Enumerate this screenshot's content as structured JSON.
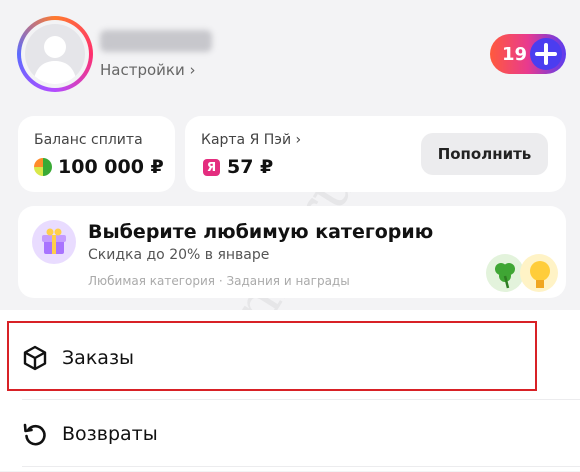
{
  "profile": {
    "name_hidden": true,
    "settings_label": "Настройки ›",
    "plus_count": "19"
  },
  "balance": {
    "split_label": "Баланс сплита",
    "split_value": "100 000 ₽",
    "pay_label": "Карта Я Пэй ›",
    "pay_value": "57 ₽",
    "pay_icon_letter": "Я",
    "topup_label": "Пополнить"
  },
  "category": {
    "title": "Выберите любимую категорию",
    "subtitle": "Скидка до 20% в январе",
    "chips": "Любимая категория · Задания и награды"
  },
  "menu": {
    "orders_label": "Заказы",
    "returns_label": "Возвраты"
  },
  "watermark": "xtenni.ru",
  "colors": {
    "background": "#f3f3f5",
    "card": "#ffffff",
    "highlight": "#d82126",
    "plus_gradient_start": "#ff5a3d",
    "plus_gradient_end": "#5a3cf0"
  },
  "icons": {
    "settings": "chevron-right-icon",
    "plus": "plus-icon",
    "split": "coin-icon",
    "pay": "yandex-pay-icon",
    "category": "gift-icon",
    "orders": "box-icon",
    "returns": "refresh-icon"
  }
}
